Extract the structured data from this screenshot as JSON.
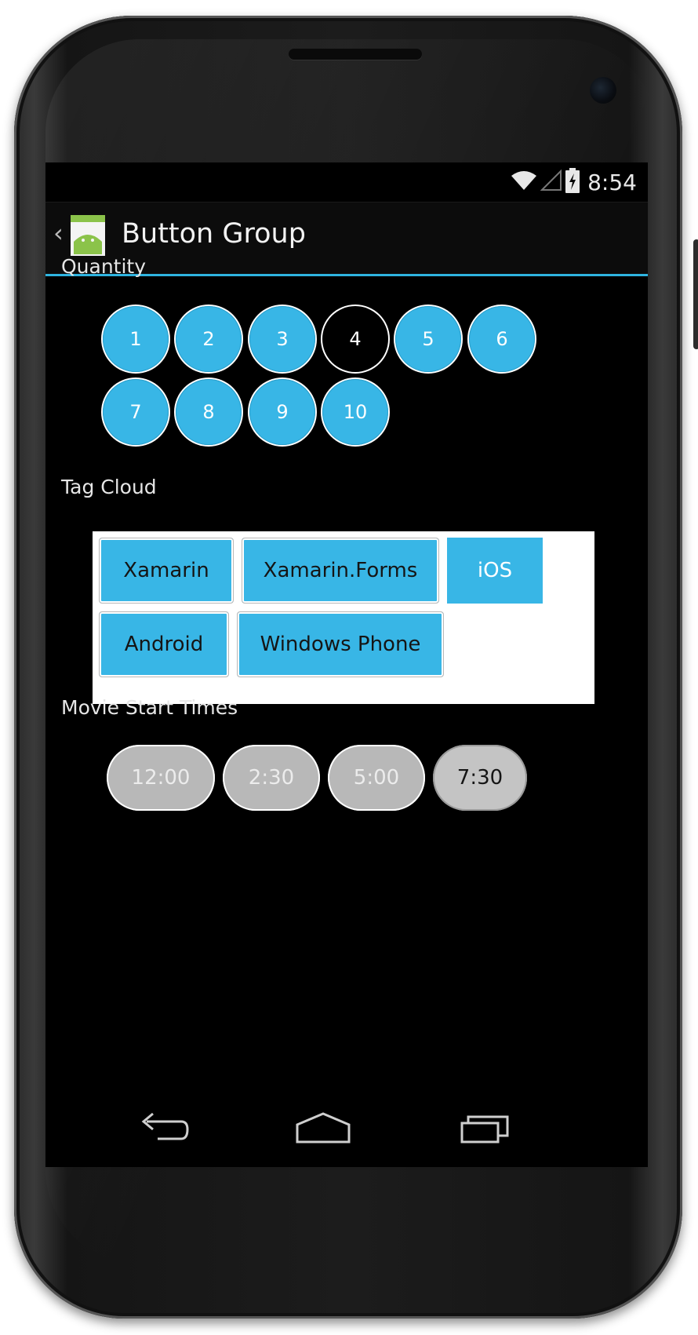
{
  "status_bar": {
    "time": "8:54",
    "icons": [
      "wifi-icon",
      "cell-signal-icon",
      "battery-charging-icon"
    ]
  },
  "action_bar": {
    "title": "Button Group",
    "icon": "android-app-icon"
  },
  "quantity": {
    "label": "Quantity",
    "options": [
      "1",
      "2",
      "3",
      "4",
      "5",
      "6",
      "7",
      "8",
      "9",
      "10"
    ],
    "selected": "4"
  },
  "tag_cloud": {
    "label": "Tag Cloud",
    "tags": [
      "Xamarin",
      "Xamarin.Forms",
      "iOS",
      "Android",
      "Windows Phone"
    ]
  },
  "movie_times": {
    "label": "Movie Start Times",
    "times": [
      "12:00",
      "2:30",
      "5:00",
      "7:30"
    ],
    "selected": "7:30"
  },
  "nav_bar": {
    "buttons": [
      "back-icon",
      "home-icon",
      "recents-icon"
    ]
  },
  "colors": {
    "accent": "#38b6e6",
    "action_bar_divider": "#2fb4e0",
    "pill": "#b8b8b8",
    "screen_background": "#000000"
  }
}
